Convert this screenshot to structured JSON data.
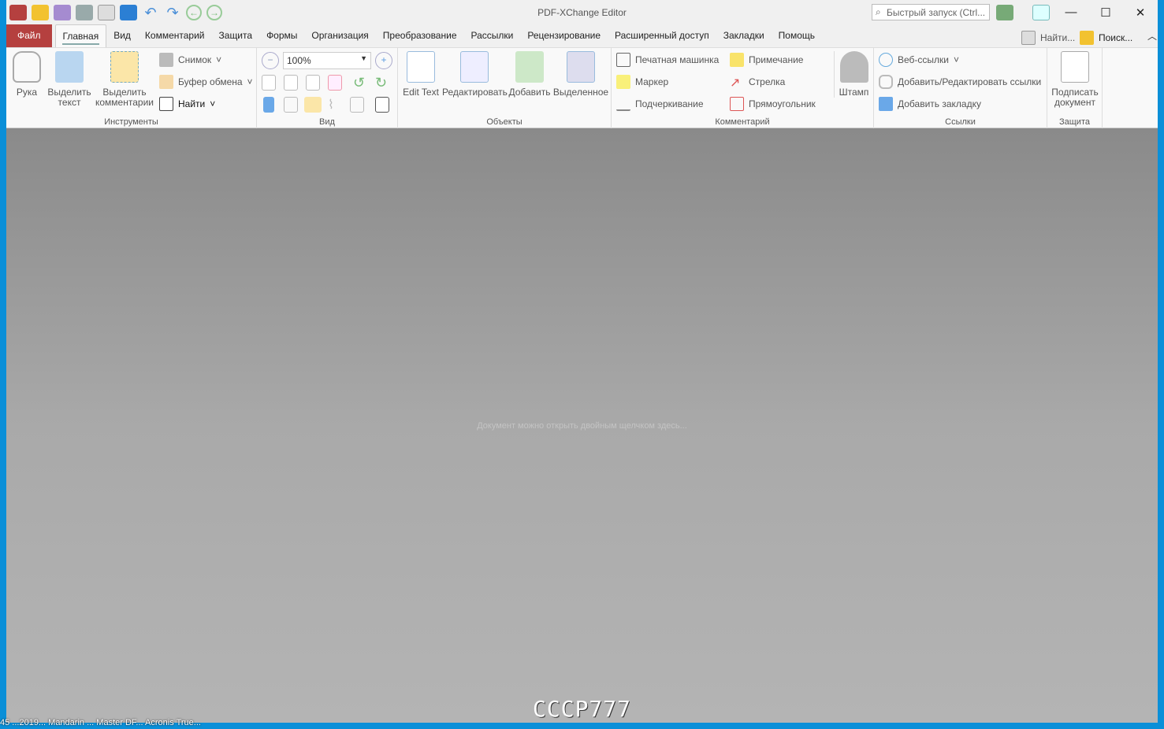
{
  "window": {
    "title": "PDF-XChange Editor",
    "quick_launch_placeholder": "Быстрый запуск (Ctrl...",
    "minimize": "—",
    "maximize": "☐",
    "close": "✕"
  },
  "tabs": [
    "Файл",
    "Главная",
    "Вид",
    "Комментарий",
    "Защита",
    "Формы",
    "Организация",
    "Преобразование",
    "Рассылки",
    "Рецензирование",
    "Расширенный доступ",
    "Закладки",
    "Помощь"
  ],
  "right_tools": {
    "find": "Найти...",
    "search": "Поиск..."
  },
  "ribbon": {
    "tools": {
      "label": "Инструменты",
      "hand": "Рука",
      "select_text": "Выделить текст",
      "select_comments": "Выделить комментарии",
      "snapshot": "Снимок",
      "clipboard": "Буфер обмена",
      "find": "Найти"
    },
    "view": {
      "label": "Вид",
      "zoom": "100%"
    },
    "objects": {
      "label": "Объекты",
      "edit_text": "Edit Text",
      "edit": "Редактировать",
      "add": "Добавить",
      "selected": "Выделенное"
    },
    "comments": {
      "label": "Комментарий",
      "typewriter": "Печатная машинка",
      "note": "Примечание",
      "highlight": "Маркер",
      "arrow": "Стрелка",
      "underline": "Подчеркивание",
      "rectangle": "Прямоугольник",
      "stamp": "Штамп"
    },
    "links": {
      "label": "Ссылки",
      "web_links": "Веб-ссылки",
      "add_edit_links": "Добавить/Редактировать ссылки",
      "add_bookmark": "Добавить закладку"
    },
    "protect": {
      "label": "Защита",
      "sign": "Подписать документ"
    }
  },
  "content": {
    "hint": "Документ можно открыть двойным щелчком здесь..."
  },
  "watermark": "CCCP777",
  "taskbar_text": "45 ...2019...  Mandarin ...  Master DF...  Acronis True..."
}
